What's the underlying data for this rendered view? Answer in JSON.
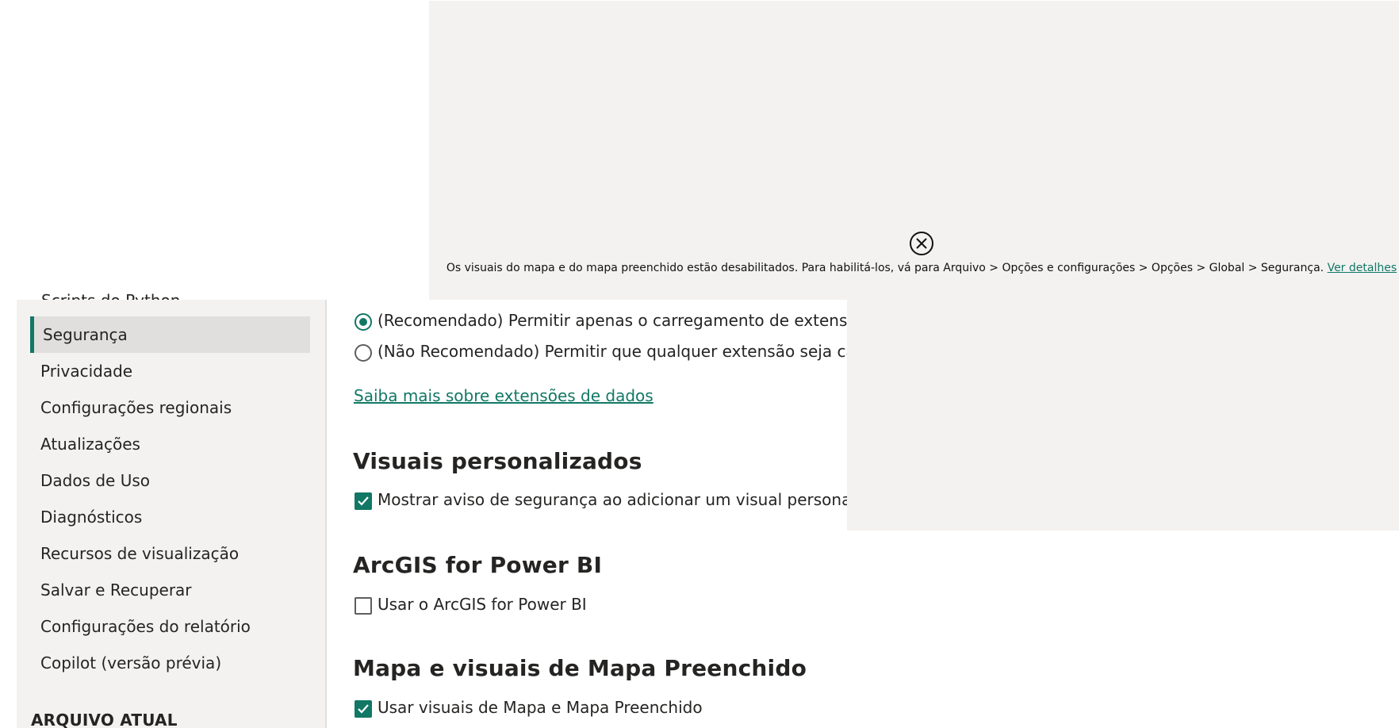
{
  "error_visual": {
    "message": "Os visuais do mapa e do mapa preenchido estão desabilitados. Para habilitá-los, vá para Arquivo > Opções e configurações > Opções > Global > Segurança.",
    "link_label": "Ver detalhes",
    "icon": "close-circle-icon"
  },
  "sidebar": {
    "partial_item": "Scripts do Python",
    "items": [
      {
        "label": "Segurança",
        "selected": true
      },
      {
        "label": "Privacidade"
      },
      {
        "label": "Configurações regionais"
      },
      {
        "label": "Atualizações"
      },
      {
        "label": "Dados de Uso"
      },
      {
        "label": "Diagnósticos"
      },
      {
        "label": "Recursos de visualização"
      },
      {
        "label": "Salvar e Recuperar"
      },
      {
        "label": "Configurações do relatório"
      },
      {
        "label": "Copilot (versão prévia)"
      }
    ],
    "section_header": "ARQUIVO ATUAL"
  },
  "main": {
    "data_extensions": {
      "option_recommended": "(Recomendado) Permitir apenas o carregamento de extensões c",
      "option_not_recommended": "(Não Recomendado) Permitir que qualquer extensão seja carreg",
      "learn_more": "Saiba mais sobre extensões de dados",
      "selected": "recommended"
    },
    "custom_visuals": {
      "heading": "Visuais personalizados",
      "checkbox_label": "Mostrar aviso de segurança ao adicionar um visual personalizac",
      "checked": true
    },
    "arcgis": {
      "heading": "ArcGIS for Power BI",
      "checkbox_label": "Usar o ArcGIS for Power BI",
      "checked": false
    },
    "map_visuals": {
      "heading": "Mapa e visuais de Mapa Preenchido",
      "checkbox_label": "Usar visuais de Mapa e Mapa Preenchido",
      "checked": true
    }
  },
  "colors": {
    "accent": "#117865",
    "panel_bg": "#f3f2f1",
    "selected_bg": "#e1dfdd"
  }
}
